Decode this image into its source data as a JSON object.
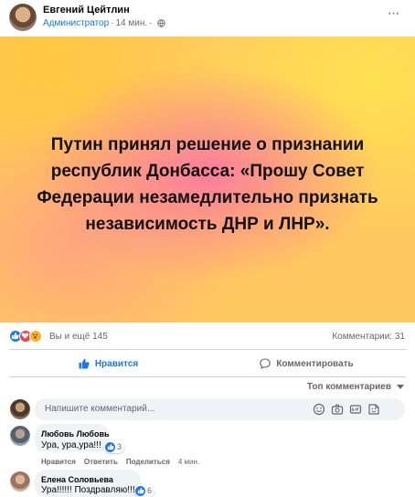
{
  "post": {
    "author": "Евгений Цейтлин",
    "role": "Администратор",
    "separator": "·",
    "time": "14 мин.",
    "separator2": "·",
    "more_label": "···"
  },
  "banner": {
    "text": "Путин принял решение о признании республик Донбасса: «Прошу Совет Федерации незамедлительно признать независимость ДНР и ЛНР».",
    "colors": {
      "base": "#ffc860",
      "pink": "#fa78a0",
      "yellow": "#ffe150"
    }
  },
  "stats": {
    "reactions": [
      "like-icon",
      "love-icon",
      "wow-icon"
    ],
    "likes_text": "Вы и ещё 145",
    "comments_text": "Комментарии: 31"
  },
  "actions": {
    "like_label": "Нравится",
    "comment_label": "Комментировать"
  },
  "comments_sort": {
    "label": "Топ комментариев"
  },
  "comment_input": {
    "placeholder": "Напишите комментарий...",
    "icons": [
      "emoji-icon",
      "camera-icon",
      "gif-icon",
      "sticker-icon"
    ]
  },
  "comments": [
    {
      "name": "Любовь Любовь",
      "text": "Ура, ура,ура!!!",
      "reaction_count": "3",
      "like": "Нравится",
      "reply": "Ответить",
      "share": "Поделиться",
      "time": "4 мин."
    },
    {
      "name": "Елена Соловьева",
      "text": "Ура!!!!!! Поздравляю!!!",
      "reaction_count": "6"
    }
  ],
  "colors": {
    "accent": "#1877f2",
    "muted": "#65676b",
    "bubble": "#f0f2f5",
    "divider": "#ced0d4"
  }
}
